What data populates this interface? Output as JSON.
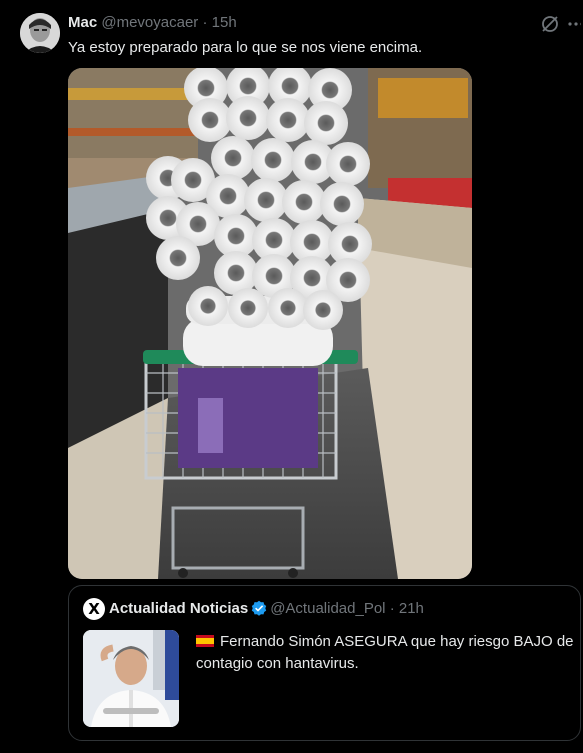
{
  "tweet": {
    "author_name": "Mac",
    "author_handle": "@mevoyacaer",
    "separator": "·",
    "time": "15h",
    "text": "Ya estoy preparado para lo que se nos viene encima.",
    "avatar_icon": "avatar-photo",
    "media_description_icon": "toilet-paper-cart-photo"
  },
  "quote": {
    "logo_letter": "X",
    "author_name": "Actualidad Noticias",
    "author_handle": "@Actualidad_Pol",
    "separator": "·",
    "time": "21h",
    "flag_icon": "spain-flag-icon",
    "text": "Fernando Simón ASEGURA que hay riesgo BAJO de contagio con hantavirus."
  },
  "colors": {
    "background": "#000000",
    "text": "#e7e9ea",
    "secondary": "#71767b",
    "border": "#2f3336",
    "verified": "#1d9bf0"
  }
}
